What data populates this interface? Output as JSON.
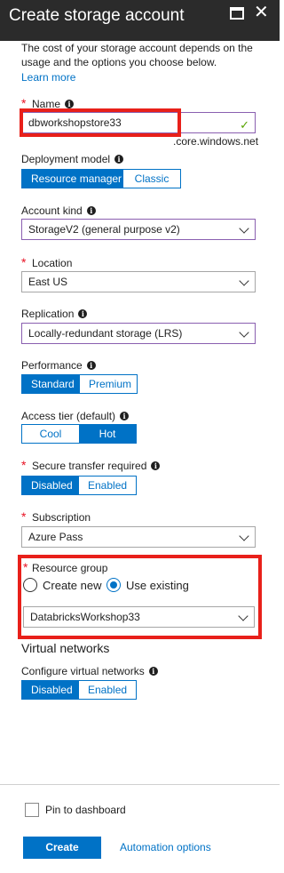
{
  "header": {
    "title": "Create storage account",
    "maximize_icon": "maximize-icon",
    "close_icon": "close-icon",
    "close_glyph": "✕"
  },
  "intro": {
    "description": "The cost of your storage account depends on the usage and the options you choose below.",
    "learn_more": "Learn more"
  },
  "name": {
    "label": "Name",
    "value": "dbworkshopstore33",
    "suffix": ".core.windows.net",
    "valid_icon": "checkmark-icon"
  },
  "deployment_model": {
    "label": "Deployment model",
    "options": [
      "Resource manager",
      "Classic"
    ],
    "selected": "Resource manager"
  },
  "account_kind": {
    "label": "Account kind",
    "value": "StorageV2 (general purpose v2)"
  },
  "location": {
    "label": "Location",
    "value": "East US"
  },
  "replication": {
    "label": "Replication",
    "value": "Locally-redundant storage (LRS)"
  },
  "performance": {
    "label": "Performance",
    "options": [
      "Standard",
      "Premium"
    ],
    "selected": "Standard"
  },
  "access_tier": {
    "label": "Access tier (default)",
    "options": [
      "Cool",
      "Hot"
    ],
    "selected": "Hot"
  },
  "secure_transfer": {
    "label": "Secure transfer required",
    "options": [
      "Disabled",
      "Enabled"
    ],
    "selected": "Disabled"
  },
  "subscription": {
    "label": "Subscription",
    "value": "Azure Pass"
  },
  "resource_group": {
    "label": "Resource group",
    "create_new": "Create new",
    "use_existing": "Use existing",
    "selected_mode": "Use existing",
    "value": "DatabricksWorkshop33"
  },
  "virtual_networks": {
    "title": "Virtual networks",
    "label": "Configure virtual networks",
    "options": [
      "Disabled",
      "Enabled"
    ],
    "selected": "Disabled"
  },
  "footer": {
    "pin_label": "Pin to dashboard",
    "pin_checked": false,
    "create_label": "Create",
    "automation_label": "Automation options"
  },
  "colors": {
    "accent": "#0072c6",
    "header_bg": "#2b2b2b",
    "required": "#e81123",
    "highlight_box": "#e8201a",
    "valid": "#57a300",
    "dropdown_border_active": "#8a5fb0"
  }
}
